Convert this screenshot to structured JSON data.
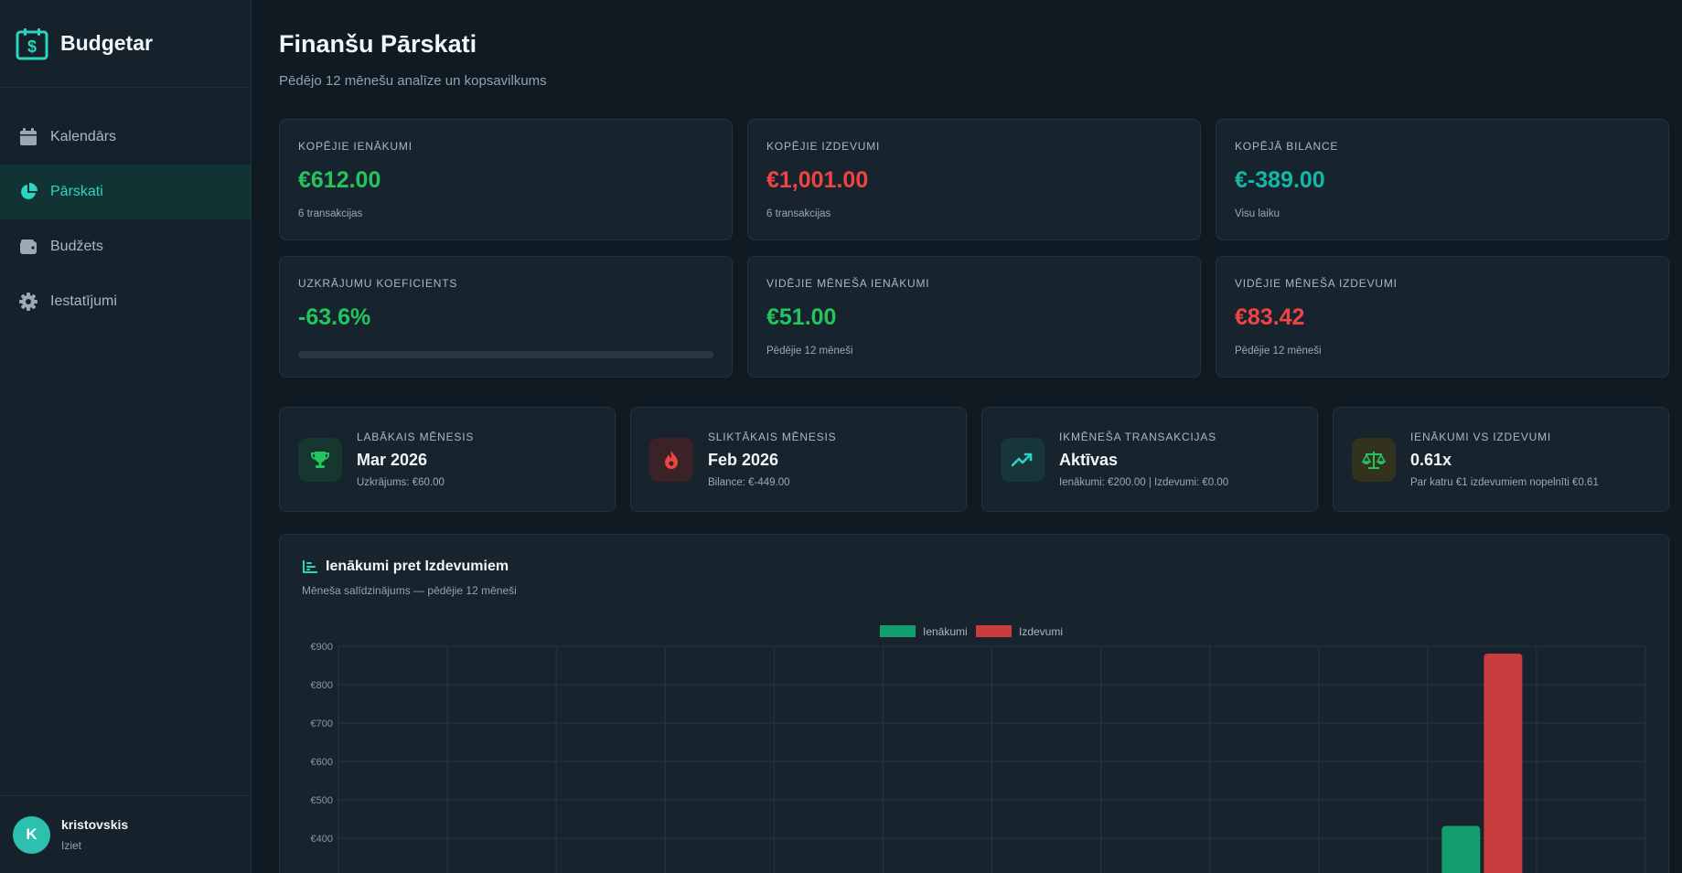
{
  "app": {
    "name": "Budgetar"
  },
  "sidebar": {
    "items": [
      {
        "label": "Kalendārs",
        "icon": "calendar-icon"
      },
      {
        "label": "Pārskati",
        "icon": "pie-chart-icon",
        "active": true
      },
      {
        "label": "Budžets",
        "icon": "wallet-icon"
      },
      {
        "label": "Iestatījumi",
        "icon": "gear-icon"
      }
    ]
  },
  "user": {
    "initial": "K",
    "name": "kristovskis",
    "logout": "Iziet"
  },
  "page": {
    "title": "Finanšu Pārskati",
    "subtitle": "Pēdējo 12 mēnešu analīze un kopsavilkums"
  },
  "stats": {
    "total_income": {
      "label": "Kopējie ienākumi",
      "value": "€612.00",
      "sub": "6 transakcijas"
    },
    "total_expenses": {
      "label": "Kopējie izdevumi",
      "value": "€1,001.00",
      "sub": "6 transakcijas"
    },
    "total_balance": {
      "label": "Kopējā bilance",
      "value": "€-389.00",
      "sub": "Visu laiku"
    },
    "savings_rate": {
      "label": "Uzkrājumu koeficients",
      "value": "-63.6%",
      "progress": 0
    },
    "avg_income": {
      "label": "Vidējie mēneša ienākumi",
      "value": "€51.00",
      "sub": "Pēdējie 12 mēneši"
    },
    "avg_expenses": {
      "label": "Vidējie mēneša izdevumi",
      "value": "€83.42",
      "sub": "Pēdējie 12 mēneši"
    }
  },
  "highlights": {
    "best_month": {
      "label": "Labākais mēnesis",
      "value": "Mar 2026",
      "sub": "Uzkrājums: €60.00",
      "icon": "trophy-icon"
    },
    "worst_month": {
      "label": "Sliktākais mēnesis",
      "value": "Feb 2026",
      "sub": "Bilance: €-449.00",
      "icon": "fire-icon"
    },
    "this_month": {
      "label": "Ikmēneša transakcijas",
      "value": "Aktīvas",
      "sub": "Ienākumi: €200.00 | Izdevumi: €0.00",
      "icon": "trending-up-icon"
    },
    "ratio": {
      "label": "Ienākumi vs izdevumi",
      "value": "0.61x",
      "sub": "Par katru €1 izdevumiem nopelnīti €0.61",
      "icon": "scale-icon"
    }
  },
  "colors": {
    "income": "#129e6f",
    "expense": "#c93d3f",
    "accent": "#2dd4bf"
  },
  "chart_data": {
    "type": "bar",
    "title": "Ienākumi pret Izdevumiem",
    "subtitle": "Mēneša salīdzinājums — pēdējie 12 mēneši",
    "ytick_labels": [
      "€400",
      "€500",
      "€600",
      "€700",
      "€800",
      "€900"
    ],
    "ylim": [
      0,
      900
    ],
    "grid": true,
    "legend": "top-center",
    "slots": 12,
    "series": [
      {
        "name": "Ienākumi",
        "color": "#129e6f",
        "values": [
          0,
          0,
          0,
          0,
          0,
          0,
          0,
          0,
          0,
          0,
          432,
          0
        ]
      },
      {
        "name": "Izdevumi",
        "color": "#c93d3f",
        "values": [
          0,
          0,
          0,
          0,
          0,
          0,
          0,
          0,
          0,
          0,
          881,
          0
        ]
      }
    ]
  }
}
